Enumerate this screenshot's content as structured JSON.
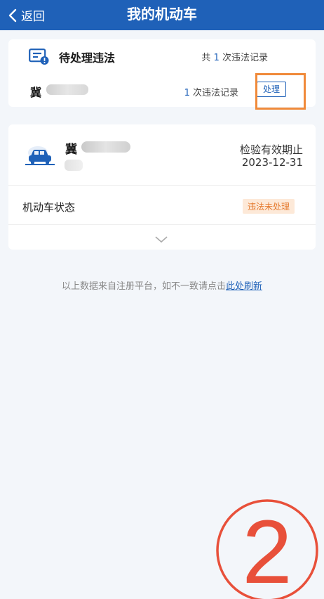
{
  "nav": {
    "back_label": "返回",
    "title": "我的机动车"
  },
  "pending": {
    "title": "待处理违法",
    "total_prefix": "共",
    "total_count": "1",
    "total_suffix": "次违法记录",
    "rows": [
      {
        "plate": "冀",
        "count": "1",
        "count_suffix": "次违法记录",
        "action_label": "处理"
      }
    ]
  },
  "vehicle": {
    "plate": "冀",
    "inspection_label": "检验有效期止",
    "inspection_date": "2023-12-31",
    "status_label": "机动车状态",
    "status_value": "违法未处理"
  },
  "footer": {
    "note": "以上数据来自注册平台，如不一致请点击",
    "link_label": "此处刷新"
  },
  "annotation": {
    "step_number": "2"
  },
  "colors": {
    "nav_blue": "#1f61b8",
    "highlight_orange": "#f08a3a",
    "step_red": "#e8503a",
    "badge_bg": "#fde9d8",
    "badge_text": "#e57a2e",
    "page_bg": "#f3f6fa"
  },
  "icons": {
    "back": "chevron-left-icon",
    "violation_doc": "document-alert-icon",
    "car": "car-icon",
    "expand": "chevron-down-icon"
  }
}
